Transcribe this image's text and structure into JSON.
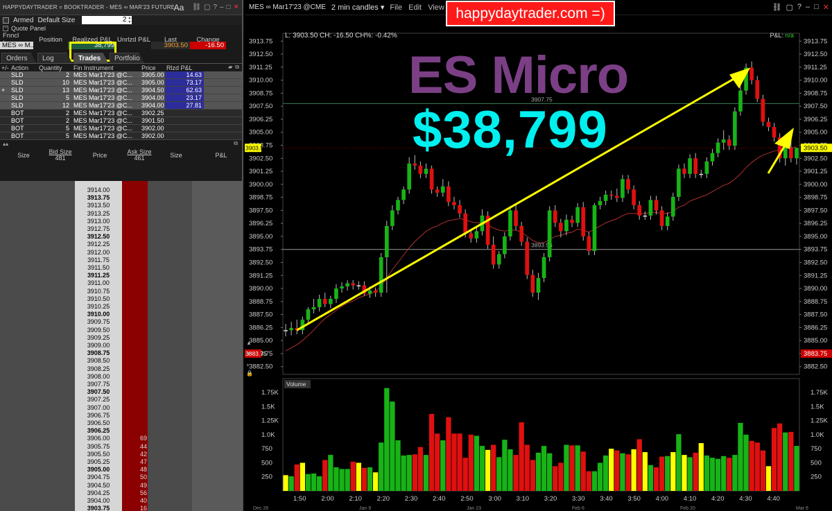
{
  "window_title": "HAPPYDAYTRADER = BOOKTRADER - MES ∞ MAR'23 FUTURES",
  "font_button": "Aa",
  "armed_label": "Armed",
  "default_size_label": "Default Size",
  "default_size_value": "2",
  "quote_panel_label": "Quote Panel",
  "quote": {
    "headers": [
      "Fnncl Ins...",
      "Position",
      "Realized P&L",
      "Unrlzd P&L",
      "Last",
      "Change"
    ],
    "instrument": "MES ∞ M...",
    "position": "",
    "realized_pnl": "38,799",
    "unrealized_pnl": "",
    "last": "3903.50",
    "change": "-16.50"
  },
  "tabs": [
    "Orders",
    "Log",
    "Trades",
    "Portfolio"
  ],
  "active_tab": "Trades",
  "trades_headers": [
    "+/-",
    "Action",
    "Quantity",
    "Fin Instrument",
    "Price",
    "Rlzd P&L"
  ],
  "trades": [
    {
      "exp": "",
      "action": "SLD",
      "qty": "2",
      "inst": "MES Mar17'23 @C...",
      "price": "3905.00",
      "pnl": "14.63"
    },
    {
      "exp": "",
      "action": "SLD",
      "qty": "10",
      "inst": "MES Mar17'23 @C...",
      "price": "3905.00",
      "pnl": "73.17"
    },
    {
      "exp": "+",
      "action": "SLD",
      "qty": "13",
      "inst": "MES Mar17'23 @C...",
      "price": "3904.50",
      "pnl": "62.63"
    },
    {
      "exp": "",
      "action": "SLD",
      "qty": "5",
      "inst": "MES Mar17'23 @C...",
      "price": "3904.00",
      "pnl": "23.17"
    },
    {
      "exp": "",
      "action": "SLD",
      "qty": "12",
      "inst": "MES Mar17'23 @C...",
      "price": "3904.00",
      "pnl": "27.81"
    },
    {
      "exp": "",
      "action": "BOT",
      "qty": "2",
      "inst": "MES Mar17'23 @C...",
      "price": "3902.25",
      "pnl": ""
    },
    {
      "exp": "",
      "action": "BOT",
      "qty": "2",
      "inst": "MES Mar17'23 @C...",
      "price": "3901.50",
      "pnl": ""
    },
    {
      "exp": "",
      "action": "BOT",
      "qty": "5",
      "inst": "MES Mar17'23 @C...",
      "price": "3902.00",
      "pnl": ""
    },
    {
      "exp": "",
      "action": "BOT",
      "qty": "5",
      "inst": "MES Mar17'23 @C...",
      "price": "3902.00",
      "pnl": ""
    }
  ],
  "book_headers": {
    "size": "Size",
    "bid_size_label": "Bid Size",
    "bid_size": "481",
    "price": "Price",
    "ask_size_label": "Ask Size",
    "ask_size": "461",
    "size2": "Size",
    "pnl": "P&L"
  },
  "book_rows": [
    {
      "p": "3914.00",
      "a": ""
    },
    {
      "p": "3913.75",
      "a": ""
    },
    {
      "p": "3913.50",
      "a": ""
    },
    {
      "p": "3913.25",
      "a": ""
    },
    {
      "p": "3913.00",
      "a": ""
    },
    {
      "p": "3912.75",
      "a": ""
    },
    {
      "p": "3912.50",
      "a": ""
    },
    {
      "p": "3912.25",
      "a": ""
    },
    {
      "p": "3912.00",
      "a": ""
    },
    {
      "p": "3911.75",
      "a": ""
    },
    {
      "p": "3911.50",
      "a": ""
    },
    {
      "p": "3911.25",
      "a": ""
    },
    {
      "p": "3911.00",
      "a": ""
    },
    {
      "p": "3910.75",
      "a": ""
    },
    {
      "p": "3910.50",
      "a": ""
    },
    {
      "p": "3910.25",
      "a": ""
    },
    {
      "p": "3910.00",
      "a": ""
    },
    {
      "p": "3909.75",
      "a": ""
    },
    {
      "p": "3909.50",
      "a": ""
    },
    {
      "p": "3909.25",
      "a": ""
    },
    {
      "p": "3909.00",
      "a": ""
    },
    {
      "p": "3908.75",
      "a": ""
    },
    {
      "p": "3908.50",
      "a": ""
    },
    {
      "p": "3908.25",
      "a": ""
    },
    {
      "p": "3908.00",
      "a": ""
    },
    {
      "p": "3907.75",
      "a": ""
    },
    {
      "p": "3907.50",
      "a": ""
    },
    {
      "p": "3907.25",
      "a": ""
    },
    {
      "p": "3907.00",
      "a": ""
    },
    {
      "p": "3906.75",
      "a": ""
    },
    {
      "p": "3906.50",
      "a": ""
    },
    {
      "p": "3906.25",
      "a": ""
    },
    {
      "p": "3906.00",
      "a": "69"
    },
    {
      "p": "3905.75",
      "a": "44"
    },
    {
      "p": "3905.50",
      "a": "42"
    },
    {
      "p": "3905.25",
      "a": "47"
    },
    {
      "p": "3905.00",
      "a": "48"
    },
    {
      "p": "3904.75",
      "a": "50"
    },
    {
      "p": "3904.50",
      "a": "49"
    },
    {
      "p": "3904.25",
      "a": "56"
    },
    {
      "p": "3904.00",
      "a": "40"
    },
    {
      "p": "3903.75",
      "a": "16"
    }
  ],
  "chart": {
    "symbol": "MES ∞ Mar17'23 @CME",
    "interval": "2 min candles",
    "menu": [
      "File",
      "Edit",
      "View"
    ],
    "brand": "happydaytrader.com =)",
    "info": "L: 3903.50 CH: -16.50 CH%: -0.42%",
    "pnl_label": "P&L:",
    "pnl_value": "n/a",
    "overlay_title": "ES Micro",
    "overlay_amount": "$38,799",
    "current_price": "3903.50",
    "low_marker": "3883.75",
    "line_high": "3907.75",
    "line_low": "3893.56",
    "volume_label": "Volume",
    "price_ticks": [
      "3913.75",
      "3912.50",
      "3911.25",
      "3910.00",
      "3908.75",
      "3907.50",
      "3906.25",
      "3905.00",
      "3903.75",
      "3902.50",
      "3901.25",
      "3900.00",
      "3898.75",
      "3897.50",
      "3896.25",
      "3895.00",
      "3893.75",
      "3892.50",
      "3891.25",
      "3890.00",
      "3888.75",
      "3887.50",
      "3886.25",
      "3885.00",
      "3883.75",
      "3882.50"
    ],
    "time_ticks": [
      "1:50",
      "2:00",
      "2:10",
      "2:20",
      "2:30",
      "2:40",
      "2:50",
      "3:00",
      "3:10",
      "3:20",
      "3:30",
      "3:40",
      "3:50",
      "4:00",
      "4:10",
      "4:20",
      "4:30",
      "4:40"
    ],
    "date_ticks": [
      "Dec 26",
      "Jan 9",
      "Jan 23",
      "Feb 6",
      "Feb 20",
      "Mar 6"
    ],
    "vol_ticks": [
      "1.75K",
      "1.5K",
      "1.25K",
      "1.0K",
      "750",
      "500",
      "250"
    ]
  },
  "chart_data": {
    "type": "candlestick",
    "x": [
      "1:46",
      "1:48",
      "1:50",
      "1:52",
      "1:54",
      "1:56",
      "1:58",
      "2:00",
      "2:02",
      "2:04",
      "2:06",
      "2:08",
      "2:10",
      "2:12",
      "2:14",
      "2:16",
      "2:18",
      "2:20",
      "2:22",
      "2:24",
      "2:26",
      "2:28",
      "2:30",
      "2:32",
      "2:34",
      "2:36",
      "2:38",
      "2:40",
      "2:42",
      "2:44",
      "2:46",
      "2:48",
      "2:50",
      "2:52",
      "2:54",
      "2:56",
      "2:58",
      "3:00",
      "3:02",
      "3:04",
      "3:06",
      "3:08",
      "3:10",
      "3:12",
      "3:14",
      "3:16",
      "3:18",
      "3:20",
      "3:22",
      "3:24",
      "3:26",
      "3:28",
      "3:30",
      "3:32",
      "3:34",
      "3:36",
      "3:38",
      "3:40",
      "3:42",
      "3:44",
      "3:46",
      "3:48",
      "3:50",
      "3:52",
      "3:54",
      "3:56",
      "3:58",
      "4:00",
      "4:02",
      "4:04",
      "4:06",
      "4:08",
      "4:10",
      "4:12",
      "4:14",
      "4:16",
      "4:18",
      "4:20",
      "4:22",
      "4:24",
      "4:26",
      "4:28",
      "4:30",
      "4:32",
      "4:34",
      "4:36",
      "4:38",
      "4:40",
      "4:42",
      "4:44",
      "4:46",
      "4:48"
    ],
    "open": [
      3886.0,
      3886.0,
      3886.2,
      3886.0,
      3887.0,
      3888.0,
      3888.2,
      3889.0,
      3888.5,
      3889.0,
      3890.0,
      3890.2,
      3890.5,
      3890.3,
      3890.3,
      3889.5,
      3889.8,
      3889.6,
      3893.0,
      3896.0,
      3897.5,
      3898.5,
      3899.5,
      3902.0,
      3901.8,
      3901.0,
      3901.5,
      3899.5,
      3899.2,
      3899.8,
      3898.3,
      3898.0,
      3897.2,
      3895.3,
      3894.8,
      3895.5,
      3897.0,
      3894.2,
      3892.3,
      3893.3,
      3895.0,
      3897.5,
      3896.0,
      3894.5,
      3891.3,
      3889.6,
      3891.0,
      3893.0,
      3897.5,
      3896.3,
      3895.5,
      3896.6,
      3896.3,
      3897.8,
      3895.0,
      3893.6,
      3898.0,
      3898.4,
      3899.0,
      3898.9,
      3898.7,
      3900.5,
      3899.5,
      3898.0,
      3897.0,
      3897.0,
      3898.5,
      3897.5,
      3896.0,
      3896.9,
      3898.8,
      3901.5,
      3901.0,
      3902.5,
      3901.0,
      3901.0,
      3902.2,
      3903.0,
      3904.0,
      3904.3,
      3903.7,
      3907.0,
      3909.0,
      3911.2,
      3910.0,
      3908.2,
      3906.0,
      3905.5,
      3904.5,
      3902.5,
      3903.5,
      3902.5
    ],
    "high": [
      3886.6,
      3886.8,
      3887.0,
      3887.3,
      3888.2,
      3889.0,
      3889.4,
      3889.6,
      3889.3,
      3890.4,
      3890.6,
      3890.8,
      3890.8,
      3890.7,
      3890.7,
      3890.2,
      3890.1,
      3893.4,
      3896.5,
      3898.0,
      3898.8,
      3899.8,
      3902.6,
      3902.8,
      3902.2,
      3902.0,
      3901.8,
      3899.8,
      3900.5,
      3900.3,
      3898.8,
      3898.5,
      3897.6,
      3895.7,
      3896.0,
      3897.6,
      3897.4,
      3895.0,
      3893.6,
      3895.4,
      3897.9,
      3898.0,
      3896.4,
      3894.9,
      3891.8,
      3891.5,
      3893.4,
      3897.9,
      3898.0,
      3896.7,
      3897.1,
      3897.0,
      3898.2,
      3898.3,
      3895.4,
      3898.2,
      3898.8,
      3899.4,
      3899.4,
      3899.6,
      3900.9,
      3900.9,
      3899.9,
      3898.4,
      3897.4,
      3898.9,
      3898.9,
      3897.9,
      3897.3,
      3899.2,
      3901.9,
      3902.0,
      3902.9,
      3903.0,
      3901.4,
      3902.6,
      3903.4,
      3904.4,
      3905.2,
      3904.7,
      3907.4,
      3909.4,
      3911.6,
      3911.8,
      3910.4,
      3908.6,
      3906.4,
      3905.9,
      3904.9,
      3903.9,
      3904.8,
      3903.2
    ],
    "low": [
      3885.4,
      3885.5,
      3885.6,
      3885.6,
      3886.6,
      3887.6,
      3887.8,
      3888.2,
      3888.1,
      3888.6,
      3889.6,
      3889.8,
      3889.9,
      3889.9,
      3889.3,
      3889.1,
      3889.2,
      3889.2,
      3889.6,
      3895.6,
      3897.1,
      3898.1,
      3899.1,
      3901.4,
      3900.6,
      3900.6,
      3899.1,
      3898.8,
      3898.8,
      3897.9,
      3897.6,
      3896.8,
      3894.9,
      3894.4,
      3894.4,
      3895.1,
      3893.8,
      3891.9,
      3891.9,
      3892.9,
      3894.6,
      3895.6,
      3894.1,
      3890.9,
      3889.2,
      3888.9,
      3890.6,
      3892.6,
      3895.9,
      3894.9,
      3895.1,
      3895.9,
      3895.9,
      3894.6,
      3893.2,
      3893.2,
      3897.6,
      3898.0,
      3898.5,
      3898.3,
      3898.3,
      3899.1,
      3897.6,
      3896.6,
      3896.6,
      3896.6,
      3897.1,
      3895.6,
      3895.6,
      3896.5,
      3898.4,
      3900.6,
      3900.6,
      3900.6,
      3900.6,
      3900.6,
      3901.8,
      3902.6,
      3903.3,
      3903.3,
      3903.3,
      3906.6,
      3908.6,
      3909.6,
      3907.9,
      3905.6,
      3905.1,
      3904.1,
      3902.1,
      3901.8,
      3902.1,
      3901.9
    ],
    "close": [
      3886.0,
      3886.2,
      3886.0,
      3887.0,
      3888.0,
      3888.2,
      3889.0,
      3888.5,
      3889.0,
      3890.0,
      3890.2,
      3890.5,
      3890.3,
      3890.3,
      3889.5,
      3889.8,
      3889.6,
      3893.0,
      3896.0,
      3897.5,
      3898.5,
      3899.5,
      3902.0,
      3901.8,
      3901.0,
      3901.5,
      3899.5,
      3899.2,
      3899.8,
      3898.3,
      3898.0,
      3897.2,
      3895.3,
      3894.8,
      3895.5,
      3897.0,
      3894.2,
      3892.3,
      3893.3,
      3895.0,
      3897.5,
      3896.0,
      3894.5,
      3891.3,
      3889.6,
      3891.0,
      3893.0,
      3897.5,
      3896.3,
      3895.5,
      3896.6,
      3896.3,
      3897.8,
      3895.0,
      3893.6,
      3898.0,
      3898.4,
      3899.0,
      3898.9,
      3898.7,
      3900.5,
      3899.5,
      3898.0,
      3897.0,
      3897.0,
      3898.5,
      3897.5,
      3896.0,
      3896.9,
      3898.8,
      3901.5,
      3901.0,
      3902.5,
      3901.0,
      3901.0,
      3902.2,
      3903.0,
      3904.0,
      3904.3,
      3903.7,
      3907.0,
      3909.0,
      3911.2,
      3910.0,
      3908.2,
      3906.0,
      3905.5,
      3904.5,
      3902.5,
      3903.5,
      3902.5,
      3903.5
    ],
    "volume": [
      280,
      260,
      470,
      500,
      300,
      310,
      260,
      550,
      640,
      420,
      390,
      390,
      520,
      500,
      410,
      420,
      330,
      860,
      1830,
      1590,
      900,
      630,
      640,
      650,
      780,
      640,
      1370,
      1020,
      900,
      1310,
      1020,
      1020,
      590,
      1000,
      980,
      800,
      730,
      820,
      600,
      910,
      740,
      640,
      1220,
      820,
      550,
      680,
      800,
      670,
      440,
      500,
      820,
      810,
      810,
      700,
      350,
      350,
      500,
      630,
      750,
      720,
      670,
      650,
      740,
      920,
      690,
      460,
      420,
      610,
      620,
      690,
      1010,
      640,
      600,
      680,
      850,
      630,
      590,
      570,
      620,
      590,
      640,
      1210,
      1000,
      890,
      860,
      720,
      440,
      1120,
      1200,
      1040,
      1050,
      800
    ],
    "sma": [
      3884.0,
      3884.3,
      3884.6,
      3885.0,
      3885.5,
      3886.0,
      3886.6,
      3887.1,
      3887.5,
      3887.9,
      3888.3,
      3888.6,
      3888.8,
      3889.1,
      3889.3,
      3889.5,
      3889.7,
      3890.2,
      3891.0,
      3891.8,
      3892.5,
      3893.2,
      3893.9,
      3894.5,
      3895.0,
      3895.5,
      3895.8,
      3896.0,
      3896.3,
      3896.5,
      3896.6,
      3896.7,
      3896.6,
      3896.4,
      3896.3,
      3896.3,
      3896.1,
      3895.8,
      3895.6,
      3895.5,
      3895.6,
      3895.6,
      3895.4,
      3895.0,
      3894.6,
      3894.4,
      3894.4,
      3894.7,
      3895.0,
      3895.1,
      3895.3,
      3895.4,
      3895.7,
      3895.6,
      3895.4,
      3895.7,
      3896.0,
      3896.3,
      3896.5,
      3896.7,
      3897.0,
      3897.2,
      3897.2,
      3897.2,
      3897.2,
      3897.3,
      3897.3,
      3897.2,
      3897.2,
      3897.4,
      3897.8,
      3898.0,
      3898.4,
      3898.6,
      3898.8,
      3899.0,
      3899.3,
      3899.6,
      3899.9,
      3900.1,
      3900.5,
      3901.0,
      3901.6,
      3902.1,
      3902.5,
      3902.8,
      3903.0,
      3903.2,
      3903.3,
      3903.4,
      3903.5,
      3903.6
    ],
    "ylim": [
      3881.75,
      3914.5
    ],
    "trend_line": [
      [
        3886.0,
        3910.8
      ]
    ]
  }
}
